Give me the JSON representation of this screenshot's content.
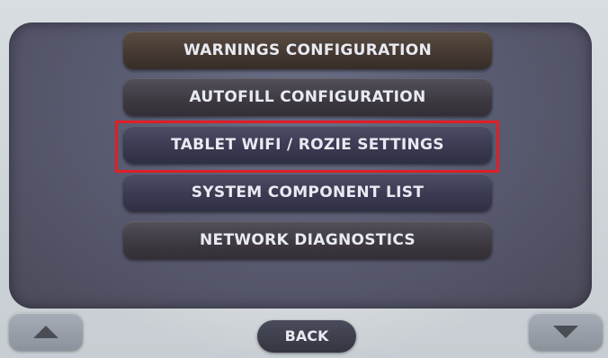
{
  "menu": {
    "items": [
      {
        "label": "WARNINGS CONFIGURATION"
      },
      {
        "label": "AUTOFILL CONFIGURATION"
      },
      {
        "label": "TABLET WIFI / ROZIE SETTINGS",
        "highlighted": true
      },
      {
        "label": "SYSTEM COMPONENT LIST"
      },
      {
        "label": "NETWORK DIAGNOSTICS"
      }
    ]
  },
  "nav": {
    "back_label": "BACK",
    "up_icon": "triangle-up-icon",
    "down_icon": "triangle-down-icon"
  },
  "colors": {
    "highlight": "#e01e27",
    "panel": "#5a5c72",
    "button": "#3f3a42",
    "text": "#e8eaf2"
  }
}
